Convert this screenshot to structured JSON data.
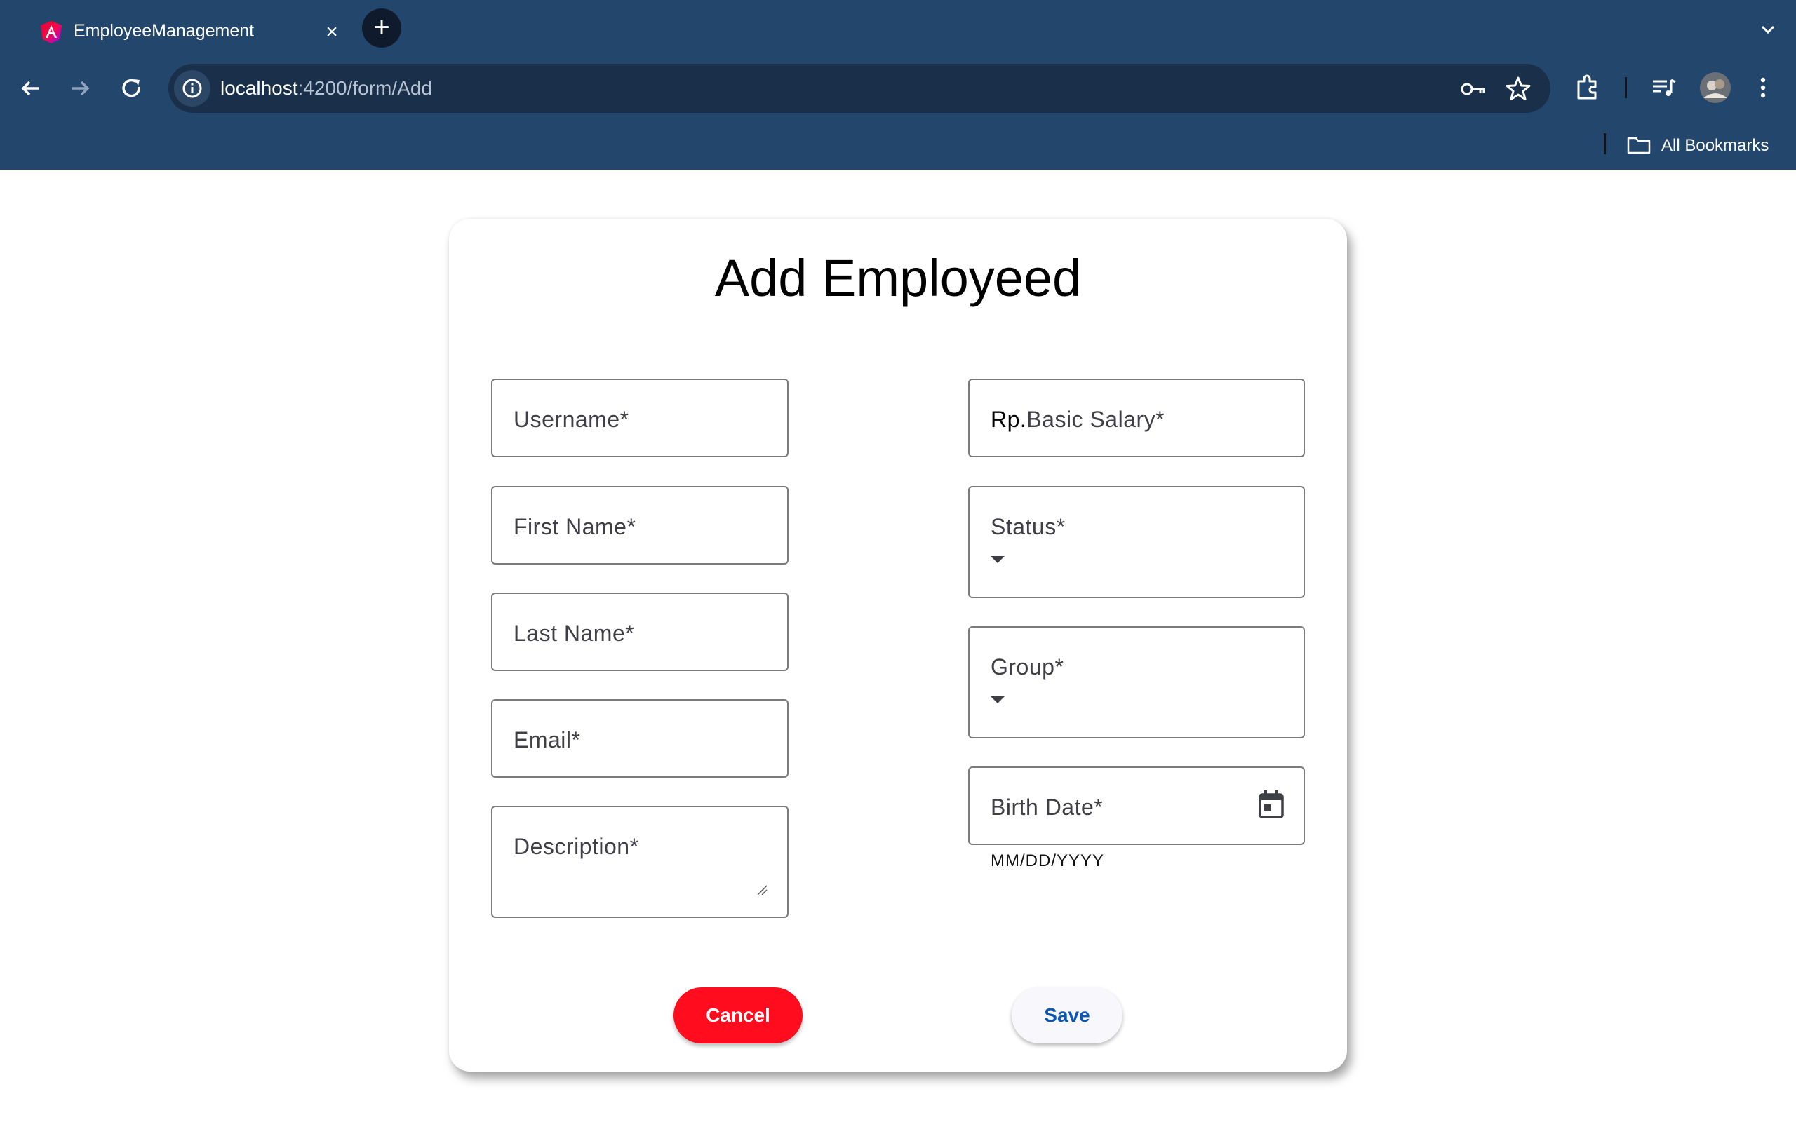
{
  "browser": {
    "tab_title": "EmployeeManagement",
    "tab_close": "×",
    "new_tab": "+",
    "url_host": "localhost",
    "url_rest": ":4200/form/Add",
    "bookmarks_label": "All Bookmarks"
  },
  "form": {
    "title": "Add Employeed",
    "username_label": "Username*",
    "first_name_label": "First Name*",
    "last_name_label": "Last Name*",
    "email_label": "Email*",
    "description_label": "Description*",
    "salary_prefix": "Rp.",
    "salary_label": "Basic Salary*",
    "status_label": "Status*",
    "group_label": "Group*",
    "birth_date_label": "Birth Date*",
    "birth_date_hint": "MM/DD/YYYY",
    "cancel_label": "Cancel",
    "save_label": "Save"
  },
  "icons": {
    "favicon": "angular-logo-icon",
    "back": "arrow-left-icon",
    "forward": "arrow-right-icon",
    "reload": "reload-icon",
    "site_info": "info-icon",
    "password": "key-icon",
    "bookmark": "star-icon",
    "extensions": "puzzle-icon",
    "media": "playlist-icon",
    "profile": "avatar",
    "menu": "kebab-menu-icon",
    "folder": "folder-icon",
    "calendar": "calendar-icon"
  },
  "colors": {
    "chrome_bg": "#23466d",
    "omnibox_bg": "#1a2f4a",
    "cancel_bg": "#ff0d1e",
    "save_text": "#0b57b3"
  }
}
